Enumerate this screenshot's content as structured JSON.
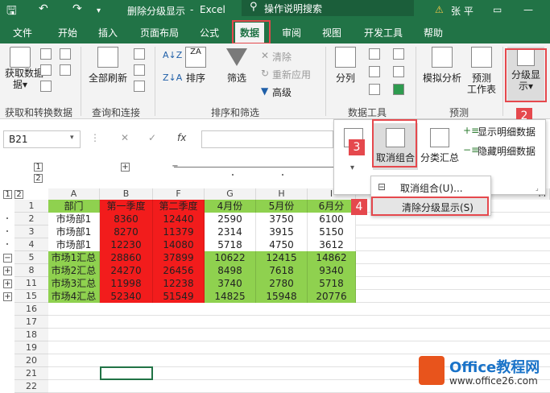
{
  "title": {
    "doc": "删除分级显示",
    "sep": "-",
    "app": "Excel",
    "search": "操作说明搜索",
    "user": "张 平"
  },
  "tabs": [
    "文件",
    "开始",
    "插入",
    "页面布局",
    "公式",
    "数据",
    "审阅",
    "视图",
    "开发工具",
    "帮助"
  ],
  "ribbon": {
    "get_data": "获取数据",
    "get_data_arrow": "据▾",
    "refresh_all": "全部刷新",
    "sort": "排序",
    "filter": "筛选",
    "clear": "清除",
    "reapply": "重新应用",
    "advanced": "高级",
    "split": "分列",
    "whatif": "模拟分析",
    "forecast_1": "预测",
    "forecast_2": "工作表",
    "outline_1": "分级显",
    "outline_2": "示▾",
    "groups": [
      "获取和转换数据",
      "查询和连接",
      "排序和筛选",
      "数据工具",
      "预测"
    ]
  },
  "formula": {
    "namebox": "B21",
    "fx": "fx"
  },
  "dropdown": {
    "ungroup": "取消组合",
    "subtotal": "分类汇总",
    "show_detail": "显示明细数据",
    "hide_detail": "隐藏明细数据"
  },
  "submenu": {
    "ungroup_item": "取消组合(U)...",
    "clear_outline": "清除分级显示(S)"
  },
  "markers": [
    "1",
    "2",
    "3",
    "4"
  ],
  "outline": {
    "levels": [
      "1",
      "2"
    ],
    "plus": "+",
    "minus": "−"
  },
  "columns": [
    "A",
    "B",
    "F",
    "G",
    "H",
    "I",
    "M"
  ],
  "rows": [
    "1",
    "2",
    "3",
    "4",
    "5",
    "8",
    "11",
    "15",
    "16",
    "17",
    "18",
    "19",
    "20",
    "21",
    "22"
  ],
  "table": {
    "header": [
      "部门",
      "第一季度",
      "第二季度",
      "4月份",
      "5月份",
      "6月分"
    ],
    "data": [
      [
        "市场部1",
        "8360",
        "12440",
        "2590",
        "3750",
        "6100"
      ],
      [
        "市场部1",
        "8270",
        "11379",
        "2314",
        "3915",
        "5150"
      ],
      [
        "市场部1",
        "12230",
        "14080",
        "5718",
        "4750",
        "3612"
      ],
      [
        "市场1汇总",
        "28860",
        "37899",
        "10622",
        "12415",
        "14862"
      ],
      [
        "市场2汇总",
        "24270",
        "26456",
        "8498",
        "7618",
        "9340"
      ],
      [
        "市场3汇总",
        "11998",
        "12238",
        "3740",
        "2780",
        "5718"
      ],
      [
        "市场4汇总",
        "52340",
        "51549",
        "14825",
        "15948",
        "20776"
      ]
    ]
  },
  "watermark": {
    "main": "Office教程网",
    "url": "www.office26.com"
  }
}
